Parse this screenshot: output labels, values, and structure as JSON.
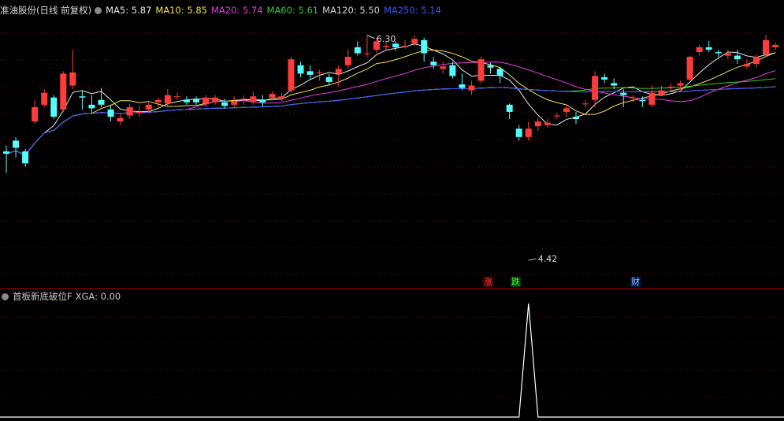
{
  "main_header": {
    "title": "准油股份(日线 前复权)",
    "ma_labels": [
      {
        "text": "MA5: 5.87",
        "color": "#e6e6e6"
      },
      {
        "text": "MA10: 5.85",
        "color": "#f2e24a"
      },
      {
        "text": "MA20: 5.74",
        "color": "#e23ee2"
      },
      {
        "text": "MA60: 5.61",
        "color": "#2ecc2e"
      },
      {
        "text": "MA120: 5.50",
        "color": "#d0d0d0"
      },
      {
        "text": "MA250: 5.14",
        "color": "#3a52ff"
      }
    ]
  },
  "sub_header": {
    "title": "首板新底破位F",
    "value_label": "XGA: 0.00"
  },
  "markers": {
    "rise": "涨",
    "fall": "跌",
    "finance": "财"
  },
  "colors": {
    "up": "#ff3b3b",
    "down": "#54fcfc",
    "grid": "#7a0000",
    "divider": "#b40000",
    "xga_line": "#ffffff"
  },
  "chart_data": {
    "type": "candlestick",
    "ylim": [
      4.25,
      6.45
    ],
    "high_annotation": {
      "index": 38,
      "value": 6.3,
      "label": "6.30"
    },
    "low_annotation": {
      "index": 55,
      "value": 4.42,
      "label": "4.42"
    },
    "candles": [
      [
        5.33,
        5.31,
        5.38,
        5.15
      ],
      [
        5.42,
        5.36,
        5.45,
        5.28
      ],
      [
        5.33,
        5.23,
        5.35,
        5.2
      ],
      [
        5.58,
        5.7,
        5.76,
        5.56
      ],
      [
        5.72,
        5.82,
        5.85,
        5.7
      ],
      [
        5.78,
        5.62,
        5.8,
        5.6
      ],
      [
        5.68,
        5.98,
        6.0,
        5.66
      ],
      [
        5.88,
        5.99,
        6.18,
        5.85
      ],
      [
        5.79,
        5.78,
        5.84,
        5.68
      ],
      [
        5.72,
        5.69,
        5.8,
        5.65
      ],
      [
        5.76,
        5.72,
        5.86,
        5.7
      ],
      [
        5.68,
        5.62,
        5.72,
        5.58
      ],
      [
        5.58,
        5.61,
        5.64,
        5.55
      ],
      [
        5.63,
        5.7,
        5.73,
        5.6
      ],
      [
        5.65,
        5.66,
        5.71,
        5.62
      ],
      [
        5.68,
        5.72,
        5.74,
        5.65
      ],
      [
        5.74,
        5.76,
        5.78,
        5.7
      ],
      [
        5.73,
        5.8,
        5.85,
        5.71
      ],
      [
        5.79,
        5.79,
        5.82,
        5.76
      ],
      [
        5.76,
        5.74,
        5.79,
        5.72
      ],
      [
        5.77,
        5.74,
        5.79,
        5.72
      ],
      [
        5.73,
        5.78,
        5.8,
        5.7
      ],
      [
        5.74,
        5.78,
        5.8,
        5.72
      ],
      [
        5.74,
        5.71,
        5.77,
        5.69
      ],
      [
        5.72,
        5.75,
        5.79,
        5.7
      ],
      [
        5.77,
        5.77,
        5.8,
        5.72
      ],
      [
        5.74,
        5.79,
        5.83,
        5.72
      ],
      [
        5.76,
        5.74,
        5.8,
        5.7
      ],
      [
        5.78,
        5.81,
        5.83,
        5.76
      ],
      [
        5.77,
        5.79,
        5.82,
        5.75
      ],
      [
        5.84,
        6.1,
        6.12,
        5.82
      ],
      [
        6.05,
        5.98,
        6.08,
        5.95
      ],
      [
        6.0,
        5.97,
        6.05,
        5.93
      ],
      [
        5.99,
        5.99,
        6.01,
        5.92
      ],
      [
        5.95,
        5.91,
        5.98,
        5.88
      ],
      [
        5.98,
        6.02,
        6.05,
        5.88
      ],
      [
        6.05,
        6.12,
        6.18,
        6.02
      ],
      [
        6.2,
        6.15,
        6.25,
        6.13
      ],
      [
        6.15,
        6.15,
        6.3,
        6.12
      ],
      [
        6.18,
        6.25,
        6.28,
        6.15
      ],
      [
        6.2,
        6.21,
        6.25,
        6.18
      ],
      [
        6.23,
        6.2,
        6.25,
        6.17
      ],
      [
        6.21,
        6.21,
        6.26,
        6.19
      ],
      [
        6.23,
        6.27,
        6.3,
        6.21
      ],
      [
        6.26,
        6.15,
        6.28,
        6.08
      ],
      [
        6.08,
        6.05,
        6.12,
        6.02
      ],
      [
        6.02,
        6.04,
        6.08,
        5.98
      ],
      [
        6.05,
        5.96,
        6.08,
        5.94
      ],
      [
        5.89,
        5.86,
        5.98,
        5.84
      ],
      [
        5.84,
        5.88,
        5.92,
        5.8
      ],
      [
        5.92,
        6.1,
        6.12,
        5.9
      ],
      [
        6.05,
        6.03,
        6.07,
        5.98
      ],
      [
        6.02,
        5.96,
        6.04,
        5.9
      ],
      [
        5.72,
        5.66,
        5.73,
        5.6
      ],
      [
        5.52,
        5.45,
        5.55,
        5.42
      ],
      [
        5.45,
        5.52,
        5.58,
        5.42
      ],
      [
        5.54,
        5.58,
        5.61,
        5.5
      ],
      [
        5.55,
        5.57,
        5.6,
        5.53
      ],
      [
        5.63,
        5.63,
        5.65,
        5.6
      ],
      [
        5.66,
        5.69,
        5.72,
        5.62
      ],
      [
        5.62,
        5.6,
        5.66,
        5.56
      ],
      [
        5.73,
        5.73,
        5.76,
        5.7
      ],
      [
        5.76,
        5.96,
        6.0,
        5.7
      ],
      [
        5.95,
        5.93,
        5.98,
        5.9
      ],
      [
        5.9,
        5.88,
        5.94,
        5.85
      ],
      [
        5.82,
        5.8,
        5.85,
        5.7
      ],
      [
        5.78,
        5.78,
        5.8,
        5.74
      ],
      [
        5.76,
        5.75,
        5.79,
        5.7
      ],
      [
        5.72,
        5.82,
        5.88,
        5.7
      ],
      [
        5.8,
        5.84,
        5.88,
        5.79
      ],
      [
        5.86,
        5.87,
        5.9,
        5.84
      ],
      [
        5.88,
        5.9,
        5.92,
        5.85
      ],
      [
        5.93,
        6.12,
        6.13,
        5.92
      ],
      [
        6.16,
        6.2,
        6.22,
        6.13
      ],
      [
        6.2,
        6.18,
        6.25,
        6.16
      ],
      [
        6.16,
        6.15,
        6.18,
        6.12
      ],
      [
        6.13,
        6.15,
        6.18,
        6.1
      ],
      [
        6.13,
        6.1,
        6.18,
        6.06
      ],
      [
        6.04,
        6.06,
        6.1,
        6.02
      ],
      [
        6.06,
        6.12,
        6.14,
        6.03
      ],
      [
        6.14,
        6.26,
        6.3,
        6.12
      ],
      [
        6.2,
        6.22,
        6.24,
        6.18
      ]
    ]
  },
  "xga": {
    "ylim": [
      0,
      1
    ],
    "values": [
      0,
      0,
      0,
      0,
      0,
      0,
      0,
      0,
      0,
      0,
      0,
      0,
      0,
      0,
      0,
      0,
      0,
      0,
      0,
      0,
      0,
      0,
      0,
      0,
      0,
      0,
      0,
      0,
      0,
      0,
      0,
      0,
      0,
      0,
      0,
      0,
      0,
      0,
      0,
      0,
      0,
      0,
      0,
      0,
      0,
      0,
      0,
      0,
      0,
      0,
      0,
      0,
      0,
      0,
      0,
      1,
      0,
      0,
      0,
      0,
      0,
      0,
      0,
      0,
      0,
      0,
      0,
      0,
      0,
      0,
      0,
      0,
      0,
      0,
      0,
      0,
      0,
      0,
      0,
      0,
      0,
      0
    ]
  }
}
